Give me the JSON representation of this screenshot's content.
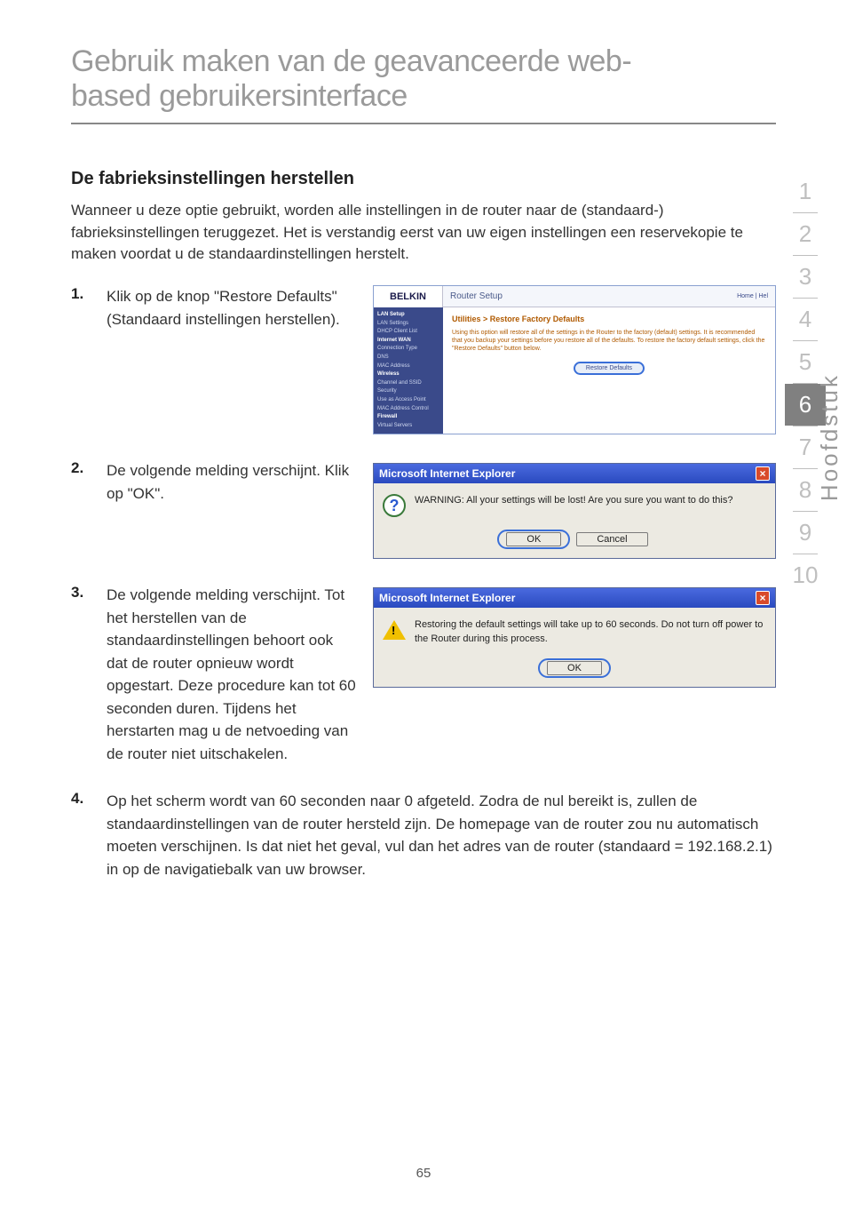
{
  "title_l1": "Gebruik maken van de geavanceerde web-",
  "title_l2": "based gebruikersinterface",
  "heading": "De fabrieksinstellingen herstellen",
  "intro": "Wanneer u deze optie gebruikt, worden alle instellingen in de router naar de (standaard-) fabrieksinstellingen teruggezet. Het is verstandig eerst van uw eigen instellingen een reservekopie te maken voordat u de standaardinstellingen herstelt.",
  "steps": {
    "n1": "1.",
    "t1": "Klik op de knop \"Restore Defaults\" (Standaard instellingen herstellen).",
    "n2": "2.",
    "t2": "De volgende melding verschijnt. Klik op \"OK\".",
    "n3": "3.",
    "t3": "De volgende melding verschijnt. Tot het herstellen van de standaardinstellingen behoort ook dat de router opnieuw wordt opgestart. Deze procedure kan tot 60 seconden duren. Tijdens het herstarten mag u de netvoeding van de router niet uitschakelen.",
    "n4": "4.",
    "t4": "Op het scherm wordt van 60 seconden naar 0 afgeteld. Zodra de nul bereikt is, zullen de standaardinstellingen van de router hersteld zijn. De homepage van de router zou nu automatisch moeten verschijnen. Is dat niet het geval, vul dan het adres van de router (standaard = 192.168.2.1) in op de navigatiebalk van uw browser."
  },
  "router": {
    "logo": "BELKIN",
    "bar": "Router Setup",
    "home": "Home | Hel",
    "breadcrumb": "Utilities > Restore Factory Defaults",
    "desc": "Using this option will restore all of the settings in the Router to the factory (default) settings. It is recommended that you backup your settings before you restore all of the defaults. To restore the factory default settings, click the \"Restore Defaults\" button below.",
    "btn": "Restore Defaults",
    "side": {
      "h1": "LAN Setup",
      "i1a": "LAN Settings",
      "i1b": "DHCP Client List",
      "h2": "Internet WAN",
      "i2a": "Connection Type",
      "i2b": "DNS",
      "i2c": "MAC Address",
      "h3": "Wireless",
      "i3a": "Channel and SSID",
      "i3b": "Security",
      "i3c": "Use as Access Point",
      "i3d": "MAC Address Control",
      "h4": "Firewall",
      "i4a": "Virtual Servers"
    }
  },
  "dlg1": {
    "title": "Microsoft Internet Explorer",
    "msg": "WARNING: All your settings will be lost! Are you sure you want to do this?",
    "ok": "OK",
    "cancel": "Cancel"
  },
  "dlg2": {
    "title": "Microsoft Internet Explorer",
    "msg": "Restoring the default settings will take up to 60 seconds. Do not turn off power to the Router during this process.",
    "ok": "OK"
  },
  "sidebar": {
    "p1": "1",
    "p2": "2",
    "p3": "3",
    "p4": "4",
    "p5": "5",
    "p6": "6",
    "p7": "7",
    "p8": "8",
    "p9": "9",
    "p10": "10"
  },
  "tablabel": "Hoofdstuk",
  "pagenum": "65"
}
